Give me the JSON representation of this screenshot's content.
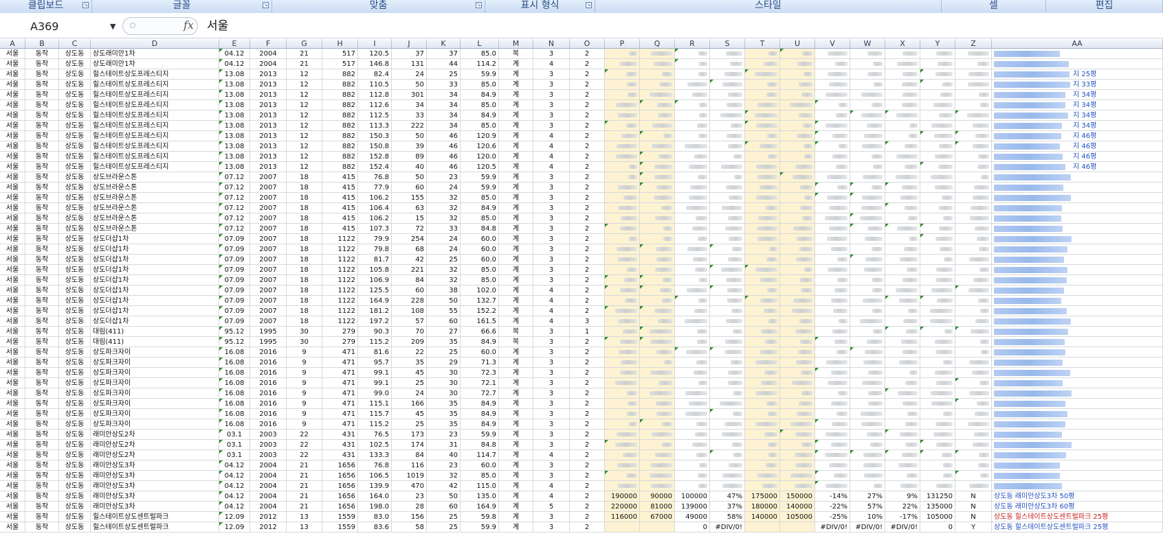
{
  "ribbon": {
    "groups": [
      {
        "label": "클립보드",
        "launcher": true
      },
      {
        "label": "글꼴",
        "launcher": true
      },
      {
        "label": "맞춤",
        "launcher": true
      },
      {
        "label": "표시 형식",
        "launcher": true
      },
      {
        "label": "스타일",
        "launcher": false
      },
      {
        "label": "셀",
        "launcher": false
      },
      {
        "label": "편집",
        "launcher": false
      }
    ]
  },
  "formula_bar": {
    "name_box": "A369",
    "fx_label": "fx",
    "formula": "서울"
  },
  "columns": [
    "A",
    "B",
    "C",
    "D",
    "E",
    "F",
    "G",
    "H",
    "I",
    "J",
    "K",
    "L",
    "M",
    "N",
    "O",
    "P",
    "Q",
    "R",
    "S",
    "T",
    "U",
    "V",
    "W",
    "X",
    "Y",
    "Z",
    "AA"
  ],
  "rows": [
    [
      "서울",
      "동작",
      "상도동",
      "상도래미안1차",
      "04.12",
      "2004",
      "21",
      "517",
      "120.5",
      "37",
      "37",
      "85.0",
      "복",
      "3",
      "2"
    ],
    [
      "서울",
      "동작",
      "상도동",
      "상도래미안1차",
      "04.12",
      "2004",
      "21",
      "517",
      "146.8",
      "131",
      "44",
      "114.2",
      "계",
      "4",
      "2"
    ],
    [
      "서울",
      "동작",
      "상도동",
      "힐스테이트상도프레스티지",
      "13.08",
      "2013",
      "12",
      "882",
      "82.4",
      "24",
      "25",
      "59.9",
      "계",
      "3",
      "2"
    ],
    [
      "서울",
      "동작",
      "상도동",
      "힐스테이트상도프레스티지",
      "13.08",
      "2013",
      "12",
      "882",
      "110.5",
      "50",
      "33",
      "85.0",
      "계",
      "3",
      "2"
    ],
    [
      "서울",
      "동작",
      "상도동",
      "힐스테이트상도프레스티지",
      "13.08",
      "2013",
      "12",
      "882",
      "112.8",
      "301",
      "34",
      "84.9",
      "계",
      "3",
      "2"
    ],
    [
      "서울",
      "동작",
      "상도동",
      "힐스테이트상도프레스티지",
      "13.08",
      "2013",
      "12",
      "882",
      "112.6",
      "34",
      "34",
      "85.0",
      "계",
      "3",
      "2"
    ],
    [
      "서울",
      "동작",
      "상도동",
      "힐스테이트상도프레스티지",
      "13.08",
      "2013",
      "12",
      "882",
      "112.5",
      "33",
      "34",
      "84.9",
      "계",
      "3",
      "2"
    ],
    [
      "서울",
      "동작",
      "상도동",
      "힐스테이트상도프레스티지",
      "13.08",
      "2013",
      "12",
      "882",
      "113.3",
      "222",
      "34",
      "85.0",
      "계",
      "3",
      "2"
    ],
    [
      "서울",
      "동작",
      "상도동",
      "힐스테이트상도프레스티지",
      "13.08",
      "2013",
      "12",
      "882",
      "150.3",
      "50",
      "46",
      "120.9",
      "계",
      "4",
      "2"
    ],
    [
      "서울",
      "동작",
      "상도동",
      "힐스테이트상도프레스티지",
      "13.08",
      "2013",
      "12",
      "882",
      "150.8",
      "39",
      "46",
      "120.6",
      "계",
      "4",
      "2"
    ],
    [
      "서울",
      "동작",
      "상도동",
      "힐스테이트상도프레스티지",
      "13.08",
      "2013",
      "12",
      "882",
      "152.8",
      "89",
      "46",
      "120.0",
      "계",
      "4",
      "2"
    ],
    [
      "서울",
      "동작",
      "상도동",
      "힐스테이트상도프레스티지",
      "13.08",
      "2013",
      "12",
      "882",
      "152.4",
      "40",
      "46",
      "120.5",
      "계",
      "4",
      "2"
    ],
    [
      "서울",
      "동작",
      "상도동",
      "상도브라운스톤",
      "07.12",
      "2007",
      "18",
      "415",
      "76.8",
      "50",
      "23",
      "59.9",
      "계",
      "3",
      "2"
    ],
    [
      "서울",
      "동작",
      "상도동",
      "상도브라운스톤",
      "07.12",
      "2007",
      "18",
      "415",
      "77.9",
      "60",
      "24",
      "59.9",
      "계",
      "3",
      "2"
    ],
    [
      "서울",
      "동작",
      "상도동",
      "상도브라운스톤",
      "07.12",
      "2007",
      "18",
      "415",
      "106.2",
      "155",
      "32",
      "85.0",
      "계",
      "3",
      "2"
    ],
    [
      "서울",
      "동작",
      "상도동",
      "상도브라운스톤",
      "07.12",
      "2007",
      "18",
      "415",
      "106.4",
      "63",
      "32",
      "84.9",
      "계",
      "3",
      "2"
    ],
    [
      "서울",
      "동작",
      "상도동",
      "상도브라운스톤",
      "07.12",
      "2007",
      "18",
      "415",
      "106.2",
      "15",
      "32",
      "85.0",
      "계",
      "3",
      "2"
    ],
    [
      "서울",
      "동작",
      "상도동",
      "상도브라운스톤",
      "07.12",
      "2007",
      "18",
      "415",
      "107.3",
      "72",
      "33",
      "84.8",
      "계",
      "3",
      "2"
    ],
    [
      "서울",
      "동작",
      "상도동",
      "상도더샵1차",
      "07.09",
      "2007",
      "18",
      "1122",
      "79.9",
      "254",
      "24",
      "60.0",
      "계",
      "3",
      "2"
    ],
    [
      "서울",
      "동작",
      "상도동",
      "상도더샵1차",
      "07.09",
      "2007",
      "18",
      "1122",
      "79.8",
      "68",
      "24",
      "60.0",
      "계",
      "3",
      "2"
    ],
    [
      "서울",
      "동작",
      "상도동",
      "상도더샵1차",
      "07.09",
      "2007",
      "18",
      "1122",
      "81.7",
      "42",
      "25",
      "60.0",
      "계",
      "3",
      "2"
    ],
    [
      "서울",
      "동작",
      "상도동",
      "상도더샵1차",
      "07.09",
      "2007",
      "18",
      "1122",
      "105.8",
      "221",
      "32",
      "85.0",
      "계",
      "3",
      "2"
    ],
    [
      "서울",
      "동작",
      "상도동",
      "상도더샵1차",
      "07.09",
      "2007",
      "18",
      "1122",
      "106.9",
      "84",
      "32",
      "85.0",
      "계",
      "3",
      "2"
    ],
    [
      "서울",
      "동작",
      "상도동",
      "상도더샵1차",
      "07.09",
      "2007",
      "18",
      "1122",
      "125.5",
      "60",
      "38",
      "102.0",
      "계",
      "4",
      "2"
    ],
    [
      "서울",
      "동작",
      "상도동",
      "상도더샵1차",
      "07.09",
      "2007",
      "18",
      "1122",
      "164.9",
      "228",
      "50",
      "132.7",
      "계",
      "4",
      "2"
    ],
    [
      "서울",
      "동작",
      "상도동",
      "상도더샵1차",
      "07.09",
      "2007",
      "18",
      "1122",
      "181.2",
      "108",
      "55",
      "152.2",
      "계",
      "4",
      "2"
    ],
    [
      "서울",
      "동작",
      "상도동",
      "상도더샵1차",
      "07.09",
      "2007",
      "18",
      "1122",
      "197.2",
      "57",
      "60",
      "161.5",
      "계",
      "4",
      "3"
    ],
    [
      "서울",
      "동작",
      "상도동",
      "대림(411)",
      "95.12",
      "1995",
      "30",
      "279",
      "90.3",
      "70",
      "27",
      "66.6",
      "복",
      "3",
      "1"
    ],
    [
      "서울",
      "동작",
      "상도동",
      "대림(411)",
      "95.12",
      "1995",
      "30",
      "279",
      "115.2",
      "209",
      "35",
      "84.9",
      "복",
      "3",
      "2"
    ],
    [
      "서울",
      "동작",
      "상도동",
      "상도파크자이",
      "16.08",
      "2016",
      "9",
      "471",
      "81.6",
      "22",
      "25",
      "60.0",
      "계",
      "3",
      "2"
    ],
    [
      "서울",
      "동작",
      "상도동",
      "상도파크자이",
      "16.08",
      "2016",
      "9",
      "471",
      "95.7",
      "35",
      "29",
      "71.3",
      "계",
      "3",
      "2"
    ],
    [
      "서울",
      "동작",
      "상도동",
      "상도파크자이",
      "16.08",
      "2016",
      "9",
      "471",
      "99.1",
      "45",
      "30",
      "72.3",
      "계",
      "3",
      "2"
    ],
    [
      "서울",
      "동작",
      "상도동",
      "상도파크자이",
      "16.08",
      "2016",
      "9",
      "471",
      "99.1",
      "25",
      "30",
      "72.1",
      "계",
      "3",
      "2"
    ],
    [
      "서울",
      "동작",
      "상도동",
      "상도파크자이",
      "16.08",
      "2016",
      "9",
      "471",
      "99.0",
      "24",
      "30",
      "72.7",
      "계",
      "3",
      "2"
    ],
    [
      "서울",
      "동작",
      "상도동",
      "상도파크자이",
      "16.08",
      "2016",
      "9",
      "471",
      "115.1",
      "166",
      "35",
      "84.9",
      "계",
      "3",
      "2"
    ],
    [
      "서울",
      "동작",
      "상도동",
      "상도파크자이",
      "16.08",
      "2016",
      "9",
      "471",
      "115.7",
      "45",
      "35",
      "84.9",
      "계",
      "3",
      "2"
    ],
    [
      "서울",
      "동작",
      "상도동",
      "상도파크자이",
      "16.08",
      "2016",
      "9",
      "471",
      "115.2",
      "25",
      "35",
      "84.9",
      "계",
      "3",
      "2"
    ],
    [
      "서울",
      "동작",
      "상도동",
      "래미안상도2차",
      "03.1",
      "2003",
      "22",
      "431",
      "76.5",
      "173",
      "23",
      "59.9",
      "계",
      "3",
      "2"
    ],
    [
      "서울",
      "동작",
      "상도동",
      "래미안상도2차",
      "03.1",
      "2003",
      "22",
      "431",
      "102.5",
      "174",
      "31",
      "84.8",
      "계",
      "3",
      "2"
    ],
    [
      "서울",
      "동작",
      "상도동",
      "래미안상도2차",
      "03.1",
      "2003",
      "22",
      "431",
      "133.3",
      "84",
      "40",
      "114.7",
      "계",
      "4",
      "2"
    ],
    [
      "서울",
      "동작",
      "상도동",
      "래미안상도3차",
      "04.12",
      "2004",
      "21",
      "1656",
      "76.8",
      "116",
      "23",
      "60.0",
      "계",
      "3",
      "2"
    ],
    [
      "서울",
      "동작",
      "상도동",
      "래미안상도3차",
      "04.12",
      "2004",
      "21",
      "1656",
      "106.5",
      "1019",
      "32",
      "85.0",
      "계",
      "3",
      "2"
    ],
    [
      "서울",
      "동작",
      "상도동",
      "래미안상도3차",
      "04.12",
      "2004",
      "21",
      "1656",
      "139.9",
      "470",
      "42",
      "115.0",
      "계",
      "4",
      "2"
    ],
    [
      "서울",
      "동작",
      "상도동",
      "래미안상도3차",
      "04.12",
      "2004",
      "21",
      "1656",
      "164.0",
      "23",
      "50",
      "135.0",
      "계",
      "4",
      "2"
    ],
    [
      "서울",
      "동작",
      "상도동",
      "래미안상도3차",
      "04.12",
      "2004",
      "21",
      "1656",
      "198.0",
      "28",
      "60",
      "164.9",
      "계",
      "5",
      "2"
    ],
    [
      "서울",
      "동작",
      "상도동",
      "힐스테이트상도센트럴파크",
      "12.09",
      "2012",
      "13",
      "1559",
      "83.0",
      "156",
      "25",
      "59.8",
      "계",
      "3",
      "2"
    ],
    [
      "서울",
      "동작",
      "상도동",
      "힐스테이트상도센트럴파크",
      "12.09",
      "2012",
      "13",
      "1559",
      "83.6",
      "58",
      "25",
      "59.9",
      "계",
      "3",
      "2"
    ]
  ],
  "visible_tail": [
    {
      "row": 43,
      "P": "190000",
      "Q": "90000",
      "R": "100000",
      "S": "47%",
      "T": "175000",
      "U": "150000",
      "V": "-14%",
      "W": "27%",
      "X": "9%",
      "Y": "131250",
      "Z": "N",
      "AA": "상도동 래미안상도3차 50평",
      "AA_red": false
    },
    {
      "row": 44,
      "P": "220000",
      "Q": "81000",
      "R": "139000",
      "S": "37%",
      "T": "180000",
      "U": "140000",
      "V": "-22%",
      "W": "57%",
      "X": "22%",
      "Y": "135000",
      "Z": "N",
      "AA": "상도동 래미안상도3차 60평",
      "AA_red": false
    },
    {
      "row": 45,
      "P": "116000",
      "Q": "67000",
      "R": "49000",
      "S": "58%",
      "T": "140000",
      "U": "105000",
      "V": "-25%",
      "W": "10%",
      "X": "-17%",
      "Y": "105000",
      "Z": "N",
      "AA": "상도동 힐스테이트상도센트럴파크 25평",
      "AA_red": true
    },
    {
      "row": 46,
      "P": "",
      "Q": "",
      "R": "0",
      "S": "#DIV/0!",
      "T": "",
      "U": "",
      "V": "#DIV/0!",
      "W": "#DIV/0!",
      "X": "#DIV/0!",
      "Y": "0",
      "Z": "Y",
      "AA": "상도동 힐스테이트상도센트럴파크 25평",
      "AA_red": false
    }
  ],
  "overflow_text": [
    {
      "row": 2,
      "text": "지 25평"
    },
    {
      "row": 3,
      "text": "지 33평"
    },
    {
      "row": 4,
      "text": "지 34평"
    },
    {
      "row": 5,
      "text": "지 34평"
    },
    {
      "row": 6,
      "text": "지 34평"
    },
    {
      "row": 7,
      "text": "지 34평"
    },
    {
      "row": 8,
      "text": "지 46평"
    },
    {
      "row": 9,
      "text": "지 46평"
    },
    {
      "row": 10,
      "text": "지 46평"
    },
    {
      "row": 11,
      "text": "지 46평"
    }
  ],
  "colors": {
    "highlight": "#fdf3d2",
    "link": "#1f4fc2",
    "error_text": "#c81d1d",
    "ribbon": "#cbdcf2"
  }
}
